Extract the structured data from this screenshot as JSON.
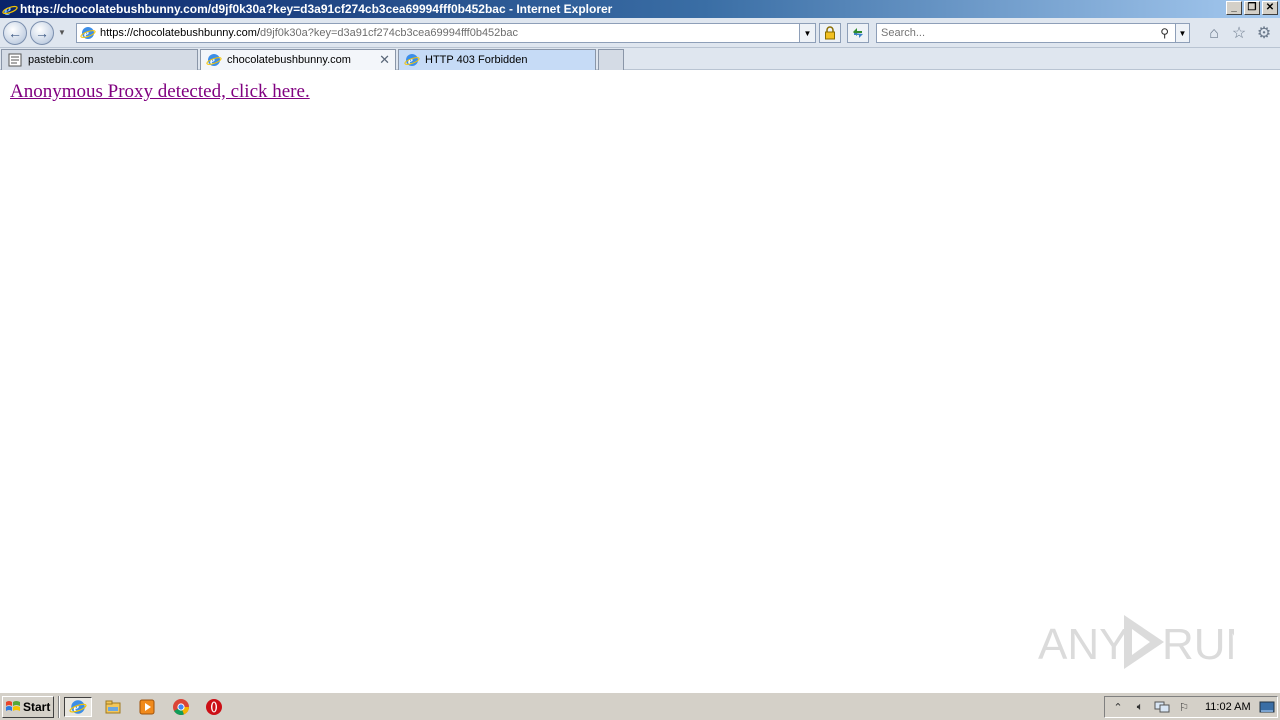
{
  "window": {
    "title": "https://chocolatebushbunny.com/d9jf0k30a?key=d3a91cf274cb3cea69994fff0b452bac - Internet Explorer",
    "minimize_label": "_",
    "restore_label": "❐",
    "close_label": "✕"
  },
  "navbar": {
    "back_glyph": "←",
    "forward_glyph": "→",
    "address_host": "https://chocolatebushbunny.com/",
    "address_path": "d9jf0k30a?key=d3a91cf274cb3cea69994fff0b452bac",
    "search_placeholder": "Search...",
    "icons": [
      "back-icon",
      "forward-icon",
      "lock-icon",
      "refresh-icon",
      "search-icon",
      "home-icon",
      "favorites-star-icon",
      "settings-gear-icon"
    ]
  },
  "tabs": [
    {
      "label": "pastebin.com",
      "icon": "pastebin-icon",
      "active": false
    },
    {
      "label": "chocolatebushbunny.com",
      "icon": "ie-page-icon",
      "active": true
    },
    {
      "label": "HTTP 403 Forbidden",
      "icon": "ie-page-icon",
      "active": false
    }
  ],
  "content": {
    "link_text": "Anonymous Proxy detected, click here.",
    "link_color": "#800080"
  },
  "watermark": {
    "text_left": "ANY",
    "text_right": "RUN"
  },
  "taskbar": {
    "start_label": "Start",
    "apps": [
      "internet-explorer-icon",
      "file-explorer-icon",
      "media-player-icon",
      "chrome-icon",
      "opera-icon"
    ],
    "clock": "11:02 AM"
  },
  "colors": {
    "titlebar_start": "#0a246a",
    "titlebar_end": "#a6caf0",
    "chrome_bg": "#dfe6ef",
    "taskbar_bg": "#d4d0c8",
    "visited_link": "#800080"
  }
}
